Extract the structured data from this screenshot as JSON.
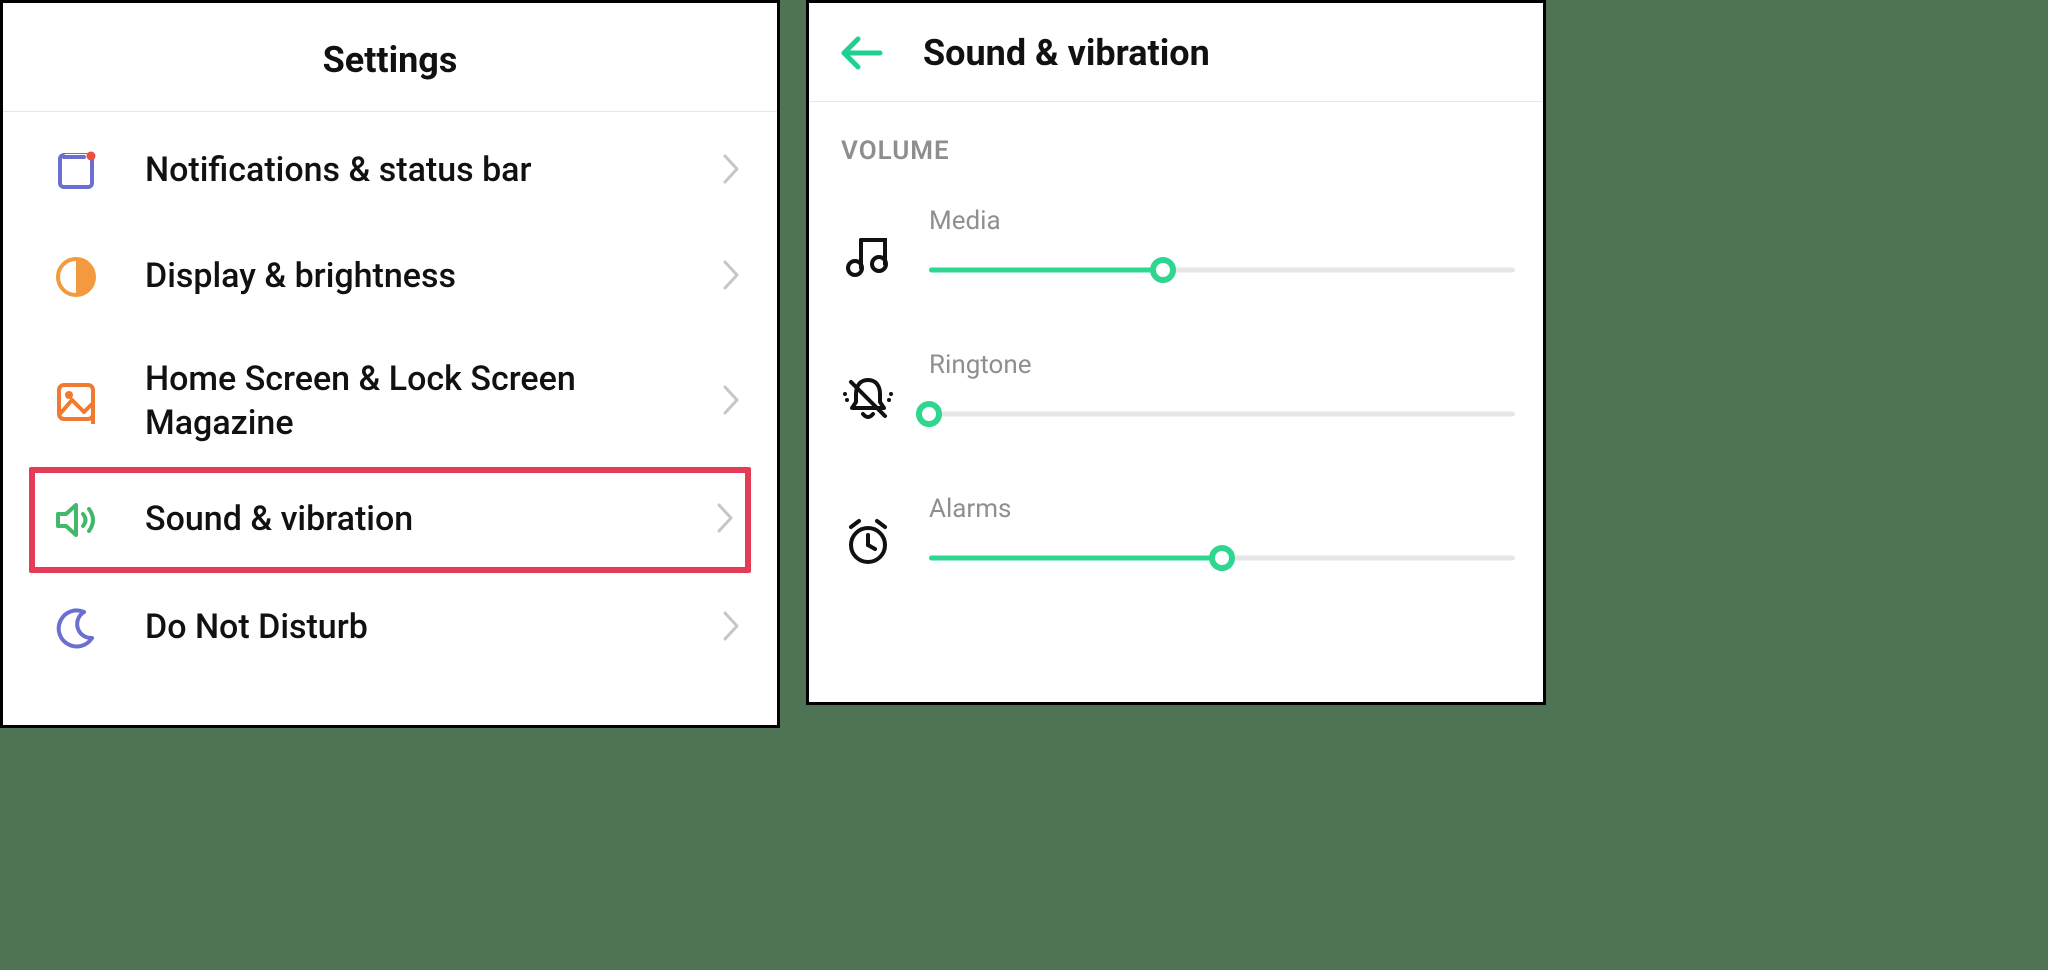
{
  "colors": {
    "accent": "#2fd68f",
    "highlight": "#e43b56",
    "orange": "#f39a3e",
    "purple": "#6a6fd1"
  },
  "settings": {
    "title": "Settings",
    "items": [
      {
        "icon": "notification-rect-icon",
        "label": "Notifications & status bar"
      },
      {
        "icon": "brightness-half-icon",
        "label": "Display & brightness"
      },
      {
        "icon": "home-magazine-icon",
        "label": "Home Screen & Lock Screen Magazine"
      },
      {
        "icon": "speaker-icon",
        "label": "Sound & vibration",
        "highlighted": true
      },
      {
        "icon": "moon-icon",
        "label": "Do Not Disturb"
      }
    ]
  },
  "sound_page": {
    "title": "Sound & vibration",
    "section_heading": "VOLUME",
    "sliders": [
      {
        "icon": "music-note-icon",
        "label": "Media",
        "value": 40
      },
      {
        "icon": "bell-muted-icon",
        "label": "Ringtone",
        "value": 0
      },
      {
        "icon": "alarm-clock-icon",
        "label": "Alarms",
        "value": 50
      }
    ]
  }
}
